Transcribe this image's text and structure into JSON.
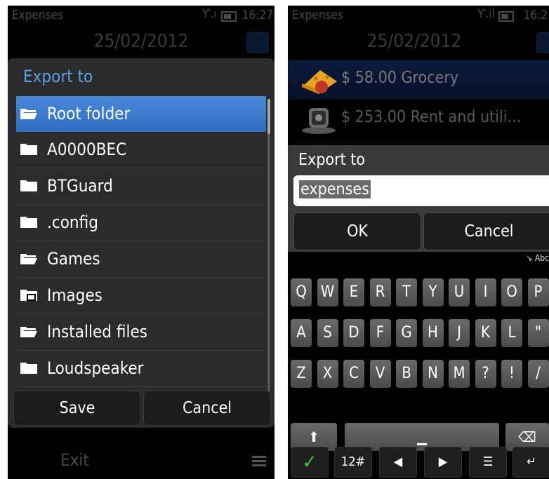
{
  "left": {
    "status": {
      "app": "Expenses",
      "time": "16:27"
    },
    "date": "25/02/2012",
    "dialog": {
      "title": "Export to",
      "folders": [
        {
          "name": "Root folder",
          "icon": "open-folder-icon"
        },
        {
          "name": "A0000BEC",
          "icon": "folder-icon"
        },
        {
          "name": "BTGuard",
          "icon": "folder-icon"
        },
        {
          "name": ".config",
          "icon": "folder-icon"
        },
        {
          "name": "Games",
          "icon": "open-folder-icon"
        },
        {
          "name": "Images",
          "icon": "image-folder-icon"
        },
        {
          "name": "Installed files",
          "icon": "open-folder-icon"
        },
        {
          "name": "Loudspeaker",
          "icon": "folder-icon"
        }
      ],
      "save_label": "Save",
      "cancel_label": "Cancel"
    },
    "bottom": {
      "exit_label": "Exit"
    }
  },
  "right": {
    "status": {
      "app": "Expenses",
      "time": "16:2"
    },
    "date": "25/02/2012",
    "entries": [
      {
        "text": "$ 58.00  Grocery",
        "icon": "cheese-icon"
      },
      {
        "text": "$ 253.00  Rent and utili...",
        "icon": "webcam-icon"
      }
    ],
    "dialog": {
      "title": "Export to",
      "input_value": "expenses",
      "ok_label": "OK",
      "cancel_label": "Cancel"
    },
    "input_mode": "Abc",
    "keyboard": {
      "row1": [
        "Q",
        "W",
        "E",
        "R",
        "T",
        "Y",
        "U",
        "I",
        "O",
        "P"
      ],
      "row2": [
        "A",
        "S",
        "D",
        "F",
        "G",
        "H",
        "J",
        "K",
        "L",
        "\""
      ],
      "row3": [
        "Z",
        "X",
        "C",
        "V",
        "B",
        "N",
        "M",
        "?",
        "!",
        "/"
      ],
      "numeric_label": "12#"
    }
  },
  "colors": {
    "accent": "#3d7fd1",
    "title": "#5aa0e6",
    "checkmark": "#36c23a"
  }
}
